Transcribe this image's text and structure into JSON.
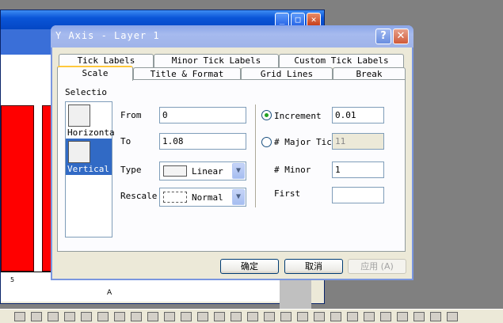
{
  "background": {
    "tick_label": "5",
    "axis_label": "A"
  },
  "dialog": {
    "title": "Y Axis - Layer 1",
    "help_label": "?",
    "close_label": "✕",
    "tabs_back": [
      "Tick Labels",
      "Minor Tick Labels",
      "Custom Tick Labels"
    ],
    "tabs_front": [
      "Scale",
      "Title & Format",
      "Grid Lines",
      "Break"
    ],
    "selection": {
      "label": "Selectio",
      "items": [
        "Horizonta",
        "Vertical"
      ]
    },
    "from_label": "From",
    "from_value": "0",
    "to_label": "To",
    "to_value": "1.08",
    "type_label": "Type",
    "type_value": "Linear",
    "rescale_label": "Rescale",
    "rescale_value": "Normal",
    "increment_label": "Increment",
    "increment_value": "0.01",
    "major_label": "# Major Ticl",
    "major_value": "11",
    "minor_label": "# Minor",
    "minor_value": "1",
    "first_label": "First",
    "first_value": "",
    "ok_label": "确定",
    "cancel_label": "取消",
    "apply_label": "应用 (A)"
  },
  "colors": {
    "accent": "#316ac5",
    "bar": "#ff0000"
  }
}
